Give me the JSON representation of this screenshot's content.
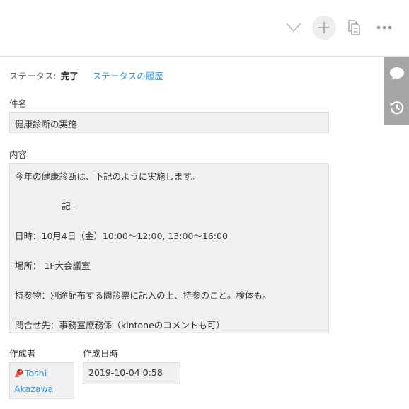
{
  "toolbar": {
    "chevron_icon": "chevron-down-icon",
    "add_icon": "plus-icon",
    "duplicate_icon": "document-copy-icon",
    "more_icon": "more-icon"
  },
  "side_panel": {
    "comment_icon": "comment-icon",
    "history_icon": "history-icon"
  },
  "status": {
    "label": "ステータス:",
    "value": "完了",
    "history_link": "ステータスの履歴"
  },
  "fields": {
    "title": {
      "label": "件名",
      "value": "健康診断の実施"
    },
    "content": {
      "label": "内容",
      "lines": [
        "今年の健康診断は、下記のように実施します。",
        "–記–",
        "日時：10月4日（金）10:00〜12:00, 13:00〜16:00",
        "場所： 1F大会議室",
        "持参物：別途配布する問診票に記入の上、持参のこと。検体も。",
        "問合せ先：事務室庶務係（kintoneのコメントも可）"
      ]
    },
    "creator": {
      "label": "作成者",
      "first_name": "Toshi",
      "last_name": "Akazawa"
    },
    "created_at": {
      "label": "作成日時",
      "value": "2019-10-04 0:58"
    }
  },
  "colors": {
    "link": "#3498db",
    "side_panel": "#a5a5a5",
    "field_bg": "#f0f0f0"
  }
}
